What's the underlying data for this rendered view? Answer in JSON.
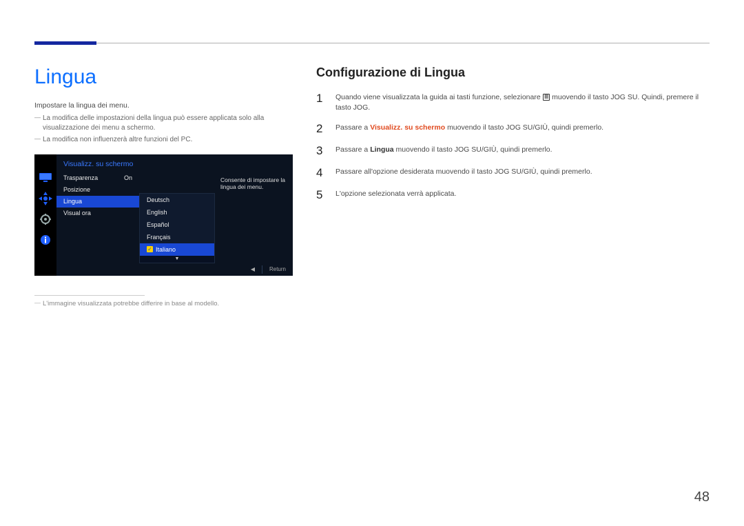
{
  "page_number": "48",
  "left": {
    "heading": "Lingua",
    "intro": "Impostare la lingua dei menu.",
    "notes": [
      "La modifica delle impostazioni della lingua può essere applicata solo alla visualizzazione dei menu a schermo.",
      "La modifica non influenzerà altre funzioni del PC."
    ],
    "footnote": "L'immagine visualizzata potrebbe differire in base al modello."
  },
  "osd": {
    "title": "Visualizz. su schermo",
    "menu": [
      {
        "label": "Trasparenza",
        "value": "On",
        "selected": false
      },
      {
        "label": "Posizione",
        "value": "",
        "selected": false
      },
      {
        "label": "Lingua",
        "value": "",
        "selected": true
      },
      {
        "label": "Visual ora",
        "value": "",
        "selected": false
      }
    ],
    "submenu": [
      {
        "label": "Deutsch",
        "selected": false
      },
      {
        "label": "English",
        "selected": false
      },
      {
        "label": "Español",
        "selected": false
      },
      {
        "label": "Français",
        "selected": false
      },
      {
        "label": "Italiano",
        "selected": true
      }
    ],
    "desc": "Consente di impostare la lingua dei menu.",
    "scroll_glyph": "▼",
    "footer_back": "◀",
    "footer_return": "Return"
  },
  "right": {
    "heading": "Configurazione di Lingua",
    "steps": {
      "s1a": "Quando viene visualizzata la guida ai tasti funzione, selezionare ",
      "s1b": " muovendo il tasto JOG SU. Quindi, premere il tasto JOG.",
      "s2a": "Passare a ",
      "s2_hl": "Visualizz. su schermo",
      "s2b": " muovendo il tasto JOG SU/GIÙ, quindi premerlo.",
      "s3a": "Passare a ",
      "s3_b": "Lingua",
      "s3b": " muovendo il tasto JOG SU/GIÙ, quindi premerlo.",
      "s4": "Passare all'opzione desiderata muovendo il tasto JOG SU/GIÙ, quindi premerlo.",
      "s5": "L'opzione selezionata verrà applicata."
    },
    "nums": [
      "1",
      "2",
      "3",
      "4",
      "5"
    ]
  }
}
